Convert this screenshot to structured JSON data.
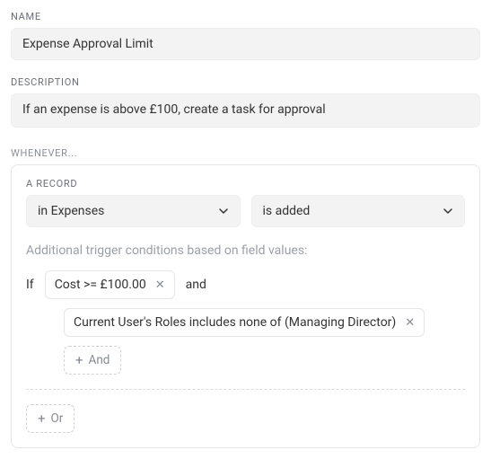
{
  "labels": {
    "name": "NAME",
    "description": "DESCRIPTION",
    "whenever": "WHENEVER...",
    "a_record": "A RECORD"
  },
  "form": {
    "name_value": "Expense Approval Limit",
    "description_value": "If an expense is above £100, create a task for approval"
  },
  "trigger": {
    "collection": "in Expenses",
    "event": "is added",
    "sub_text": "Additional trigger conditions based on field values:",
    "if_text": "If",
    "and_text": "and",
    "conditions": [
      "Cost >= £100.00",
      "Current User's Roles includes none of (Managing Director)"
    ],
    "add_and_label": "And",
    "add_or_label": "Or"
  }
}
